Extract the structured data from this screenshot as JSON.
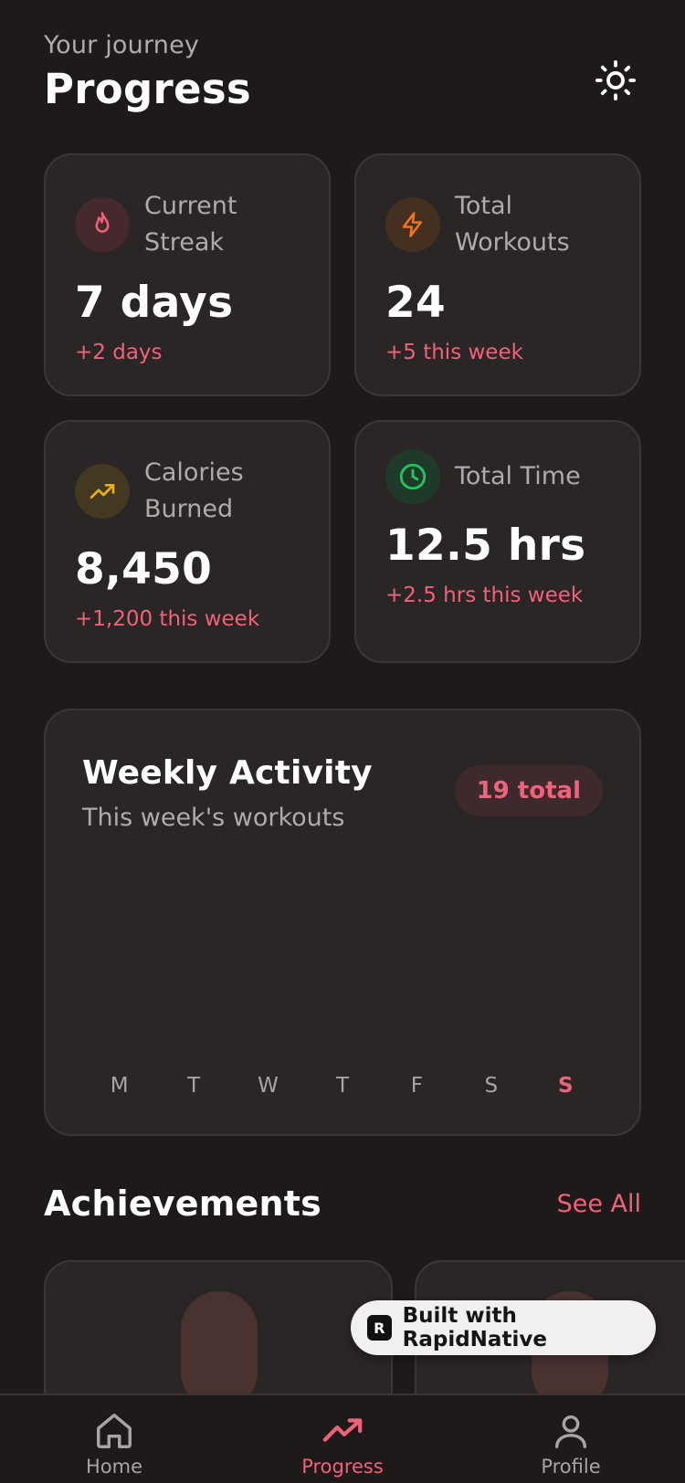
{
  "header": {
    "subtitle": "Your journey",
    "title": "Progress"
  },
  "stats": [
    {
      "label": "Current Streak",
      "value": "7 days",
      "change": "+2 days",
      "icon": "flame-icon",
      "color": "#f2617a"
    },
    {
      "label": "Total Workouts",
      "value": "24",
      "change": "+5 this week",
      "icon": "lightning-icon",
      "color": "#f97316"
    },
    {
      "label": "Calories Burned",
      "value": "8,450",
      "change": "+1,200 this week",
      "icon": "trending-up-icon",
      "color": "#eab308"
    },
    {
      "label": "Total Time",
      "value": "12.5 hrs",
      "change": "+2.5 hrs this week",
      "icon": "clock-icon",
      "color": "#22c55e"
    }
  ],
  "weekly": {
    "title": "Weekly Activity",
    "subtitle": "This week's workouts",
    "badge": "19 total",
    "days": [
      "M",
      "T",
      "W",
      "T",
      "F",
      "S",
      "S"
    ],
    "active_day_index": 6
  },
  "achievements": {
    "title": "Achievements",
    "see_all": "See All"
  },
  "built_with": "Built with RapidNative",
  "nav": [
    {
      "label": "Home",
      "icon": "home-icon",
      "active": false
    },
    {
      "label": "Progress",
      "icon": "trending-up-icon",
      "active": true
    },
    {
      "label": "Profile",
      "icon": "user-icon",
      "active": false
    }
  ],
  "colors": {
    "accent": "#f2617a",
    "background": "#1d1a19",
    "card": "#2a2625"
  }
}
